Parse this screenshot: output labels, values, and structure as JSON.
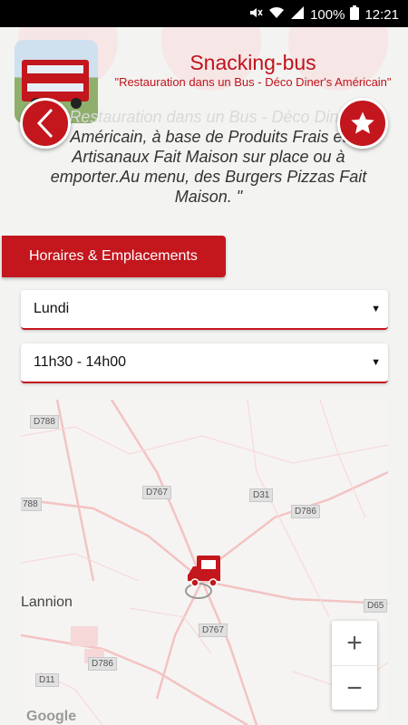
{
  "status_bar": {
    "battery": "100%",
    "time": "12:21"
  },
  "header": {
    "title": "Snacking-bus",
    "subtitle": "\"Restauration dans un Bus - Déco Diner's Américain\""
  },
  "description": {
    "faded_line": "Restauration dans un Bus - Déco Dine",
    "text": "Américain, à base de Produits Frais et Artisanaux Fait Maison sur place ou à emporter.Au menu, des Burgers Pizzas Fait Maison. \""
  },
  "section": {
    "label": "Horaires & Emplacements"
  },
  "selects": {
    "day": {
      "value": "Lundi",
      "caret": "▼"
    },
    "time": {
      "value": "11h30 - 14h00",
      "caret": "▼"
    }
  },
  "map": {
    "city": "Lannion",
    "road_labels": [
      "D788",
      "788",
      "D767",
      "D31",
      "D786",
      "D65",
      "D767",
      "D786",
      "D11",
      "D65"
    ],
    "attribution": "Google",
    "zoom_in": "+",
    "zoom_out": "−"
  },
  "colors": {
    "brand_red": "#c3161d",
    "background": "#f3f3f1"
  },
  "icons": {
    "back": "chevron-left-icon",
    "favorite": "star-icon",
    "marker": "food-truck-icon"
  }
}
